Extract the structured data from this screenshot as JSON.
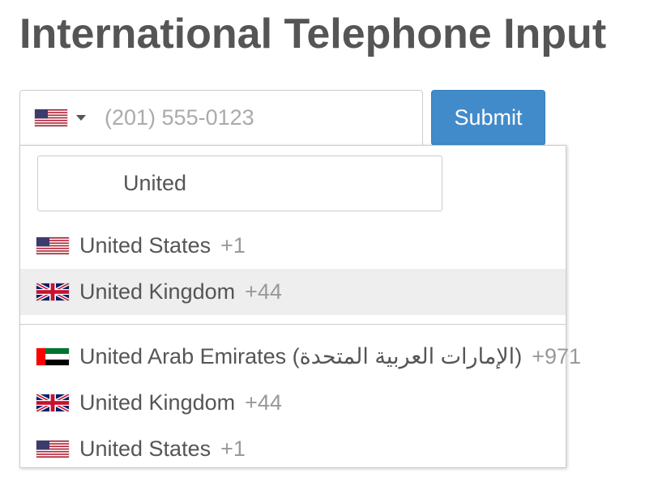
{
  "page": {
    "title": "International Telephone Input"
  },
  "phone_input": {
    "selected_flag": "us-flag-icon",
    "placeholder": "(201) 555-0123",
    "value": ""
  },
  "submit_button": {
    "label": "Submit",
    "color": "#428bca"
  },
  "dropdown": {
    "search": {
      "value": "United"
    },
    "preferred": [
      {
        "flag": "us-flag-icon",
        "name": "United States",
        "dial_code": "+1",
        "highlighted": false
      },
      {
        "flag": "uk-flag-icon",
        "name": "United Kingdom",
        "dial_code": "+44",
        "highlighted": true
      }
    ],
    "countries": [
      {
        "flag": "uae-flag-icon",
        "name": "United Arab Emirates (‫الإمارات العربية المتحدة‬‎)",
        "dial_code": "+971"
      },
      {
        "flag": "uk-flag-icon",
        "name": "United Kingdom",
        "dial_code": "+44"
      },
      {
        "flag": "us-flag-icon",
        "name": "United States",
        "dial_code": "+1"
      }
    ],
    "highlight_color": "#eeeeee"
  }
}
